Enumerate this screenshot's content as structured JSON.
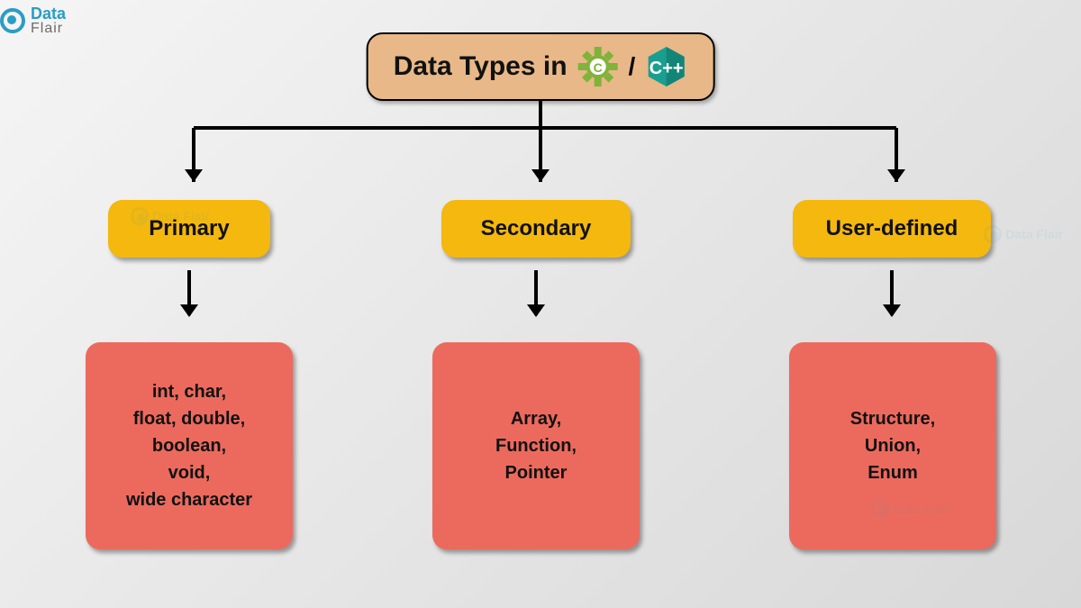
{
  "logo": {
    "line1": "Data",
    "line2": "Flair"
  },
  "title": {
    "text": "Data Types in",
    "separator": "/"
  },
  "categories": [
    {
      "label": "Primary",
      "details": "int, char,\nfloat, double,\nboolean,\nvoid,\nwide character"
    },
    {
      "label": "Secondary",
      "details": "Array,\nFunction,\nPointer"
    },
    {
      "label": "User-defined",
      "details": "Structure,\nUnion,\nEnum"
    }
  ],
  "watermark": "Data Flair"
}
